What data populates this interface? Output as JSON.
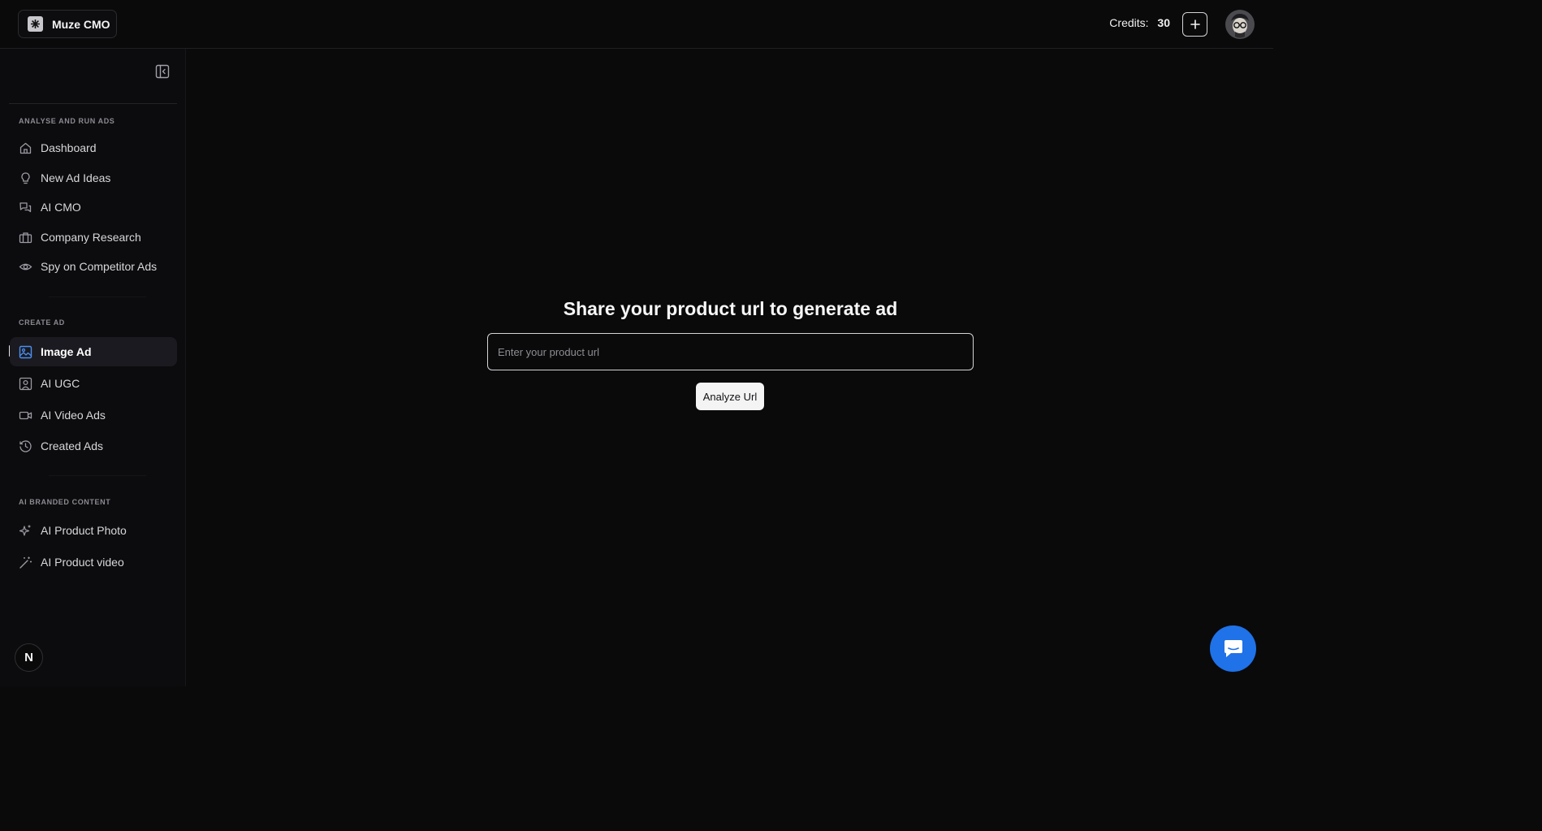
{
  "brand": {
    "name": "Muze CMO",
    "logo_icon": "brand-logo-icon"
  },
  "header": {
    "credits_label": "Credits:",
    "credits_value": "30",
    "add_credits_icon": "plus-icon",
    "avatar_icon": "user-avatar"
  },
  "sidebar": {
    "collapse_icon": "sidebar-collapse-icon",
    "sections": [
      {
        "label": "ANALYSE AND RUN ADS",
        "items": [
          {
            "label": "Dashboard",
            "icon": "home-icon"
          },
          {
            "label": "New Ad Ideas",
            "icon": "lightbulb-icon"
          },
          {
            "label": "AI CMO",
            "icon": "chat-icon"
          },
          {
            "label": "Company Research",
            "icon": "briefcase-icon"
          },
          {
            "label": "Spy on Competitor Ads",
            "icon": "eye-icon"
          }
        ]
      },
      {
        "label": "CREATE AD",
        "items": [
          {
            "label": "Image Ad",
            "icon": "image-icon",
            "active": true
          },
          {
            "label": "AI UGC",
            "icon": "user-square-icon"
          },
          {
            "label": "AI Video Ads",
            "icon": "video-icon"
          },
          {
            "label": "Created Ads",
            "icon": "history-icon"
          }
        ]
      },
      {
        "label": "AI BRANDED CONTENT",
        "items": [
          {
            "label": "AI Product Photo",
            "icon": "sparkles-icon"
          },
          {
            "label": "AI Product video",
            "icon": "wand-icon"
          }
        ]
      }
    ],
    "footer_badge": "N"
  },
  "main": {
    "title": "Share your product url to generate ad",
    "input_placeholder": "Enter your product url",
    "input_value": "",
    "analyze_button": "Analyze Url"
  },
  "chat_widget": {
    "icon": "chat-bubble-icon"
  },
  "colors": {
    "background": "#0a0a0b",
    "sidebar_active": "#1a1a20",
    "accent_blue": "#1f72e8",
    "active_icon": "#4d8ff0"
  }
}
